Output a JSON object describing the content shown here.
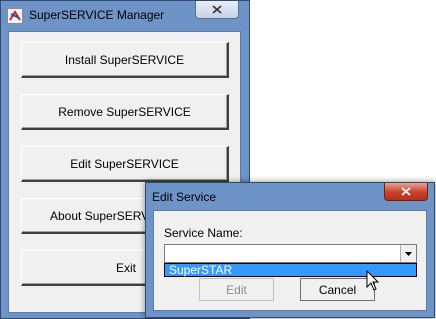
{
  "main_window": {
    "title": "SuperSERVICE Manager",
    "buttons": [
      {
        "label": "Install SuperSERVICE"
      },
      {
        "label": "Remove SuperSERVICE"
      },
      {
        "label": "Edit SuperSERVICE"
      },
      {
        "label": "About SuperSERVICE"
      },
      {
        "label": "Exit"
      }
    ]
  },
  "dialog": {
    "title": "Edit Service",
    "service_label": "Service Name:",
    "service_value": "",
    "dropdown_items": [
      "SuperSTAR"
    ],
    "edit_label": "Edit",
    "cancel_label": "Cancel"
  },
  "colors": {
    "frame": "#6e93c7",
    "selection": "#3399ff",
    "close_red": "#c7412b"
  },
  "icons": [
    "app-icon",
    "close-icon",
    "chevron-down-icon",
    "mouse-cursor-icon"
  ]
}
